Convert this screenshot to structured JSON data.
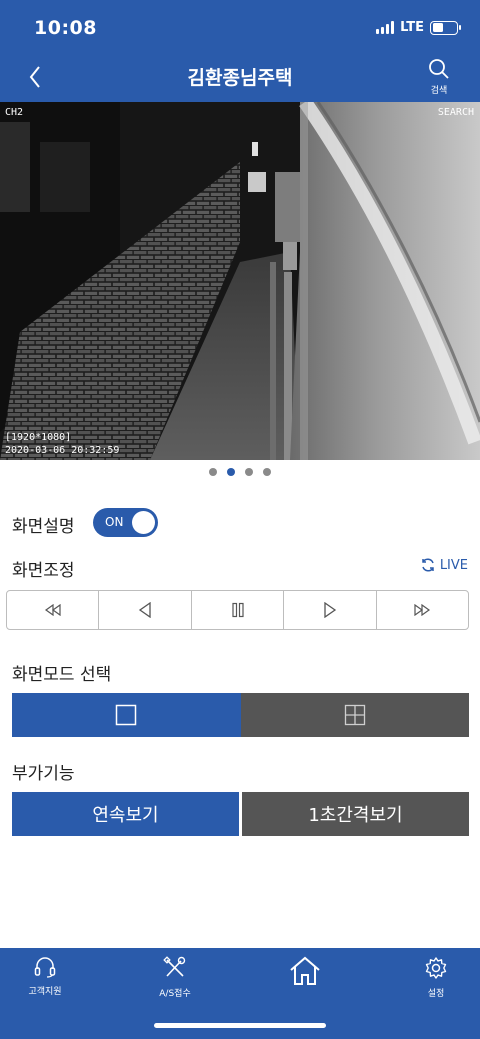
{
  "status": {
    "time": "10:08",
    "network": "LTE"
  },
  "header": {
    "title": "김환종님주택",
    "search_label": "검색"
  },
  "video": {
    "channel": "CH2",
    "search": "SEARCH",
    "resolution": "[1920*1080]",
    "timestamp": "2020-03-06 20:32:59"
  },
  "pager": {
    "count": 4,
    "active": 1
  },
  "screen_desc": {
    "title": "화면설명",
    "toggle_label": "ON"
  },
  "screen_ctrl": {
    "title": "화면조정",
    "live_label": "LIVE",
    "buttons": [
      "rewind-icon",
      "step-back-icon",
      "pause-icon",
      "play-icon",
      "fast-forward-icon"
    ]
  },
  "screen_mode": {
    "title": "화면모드 선택",
    "options": [
      "single-view-icon",
      "quad-view-icon"
    ]
  },
  "extra": {
    "title": "부가기능",
    "continuous": "연속보기",
    "interval": "1초간격보기"
  },
  "tabbar": {
    "support": "고객지원",
    "as": "A/S접수",
    "settings": "설정"
  },
  "colors": {
    "brand": "#2a5bab",
    "inactive": "#555555"
  }
}
